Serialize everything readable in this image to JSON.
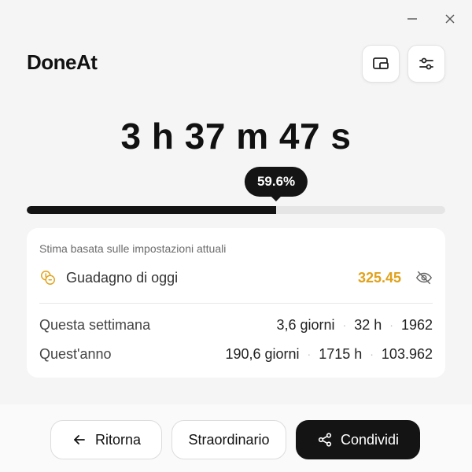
{
  "app": {
    "title": "DoneAt"
  },
  "timer": {
    "display": "3 h 37 m 47 s"
  },
  "progress": {
    "value": 0.596,
    "label": "59.6%"
  },
  "summary": {
    "note": "Stima basata sulle impostazioni attuali",
    "today": {
      "label": "Guadagno di oggi",
      "value": "325.45"
    },
    "week": {
      "label": "Questa settimana",
      "days": "3,6 giorni",
      "hours": "32 h",
      "amount": "1962"
    },
    "year": {
      "label": "Quest'anno",
      "days": "190,6 giorni",
      "hours": "1715 h",
      "amount": "103.962"
    }
  },
  "buttons": {
    "back": "Ritorna",
    "overtime": "Straordinario",
    "share": "Condividi"
  },
  "icons": {
    "minimize": "minimize-icon",
    "close": "close-icon",
    "pip": "picture-in-picture-icon",
    "settings": "sliders-icon",
    "coins": "coins-icon",
    "hide": "eye-off-icon",
    "back": "arrow-left-icon",
    "share": "share-icon"
  },
  "colors": {
    "accent": "#141414",
    "earning": "#e0a21c",
    "track": "#e5e5e5"
  }
}
